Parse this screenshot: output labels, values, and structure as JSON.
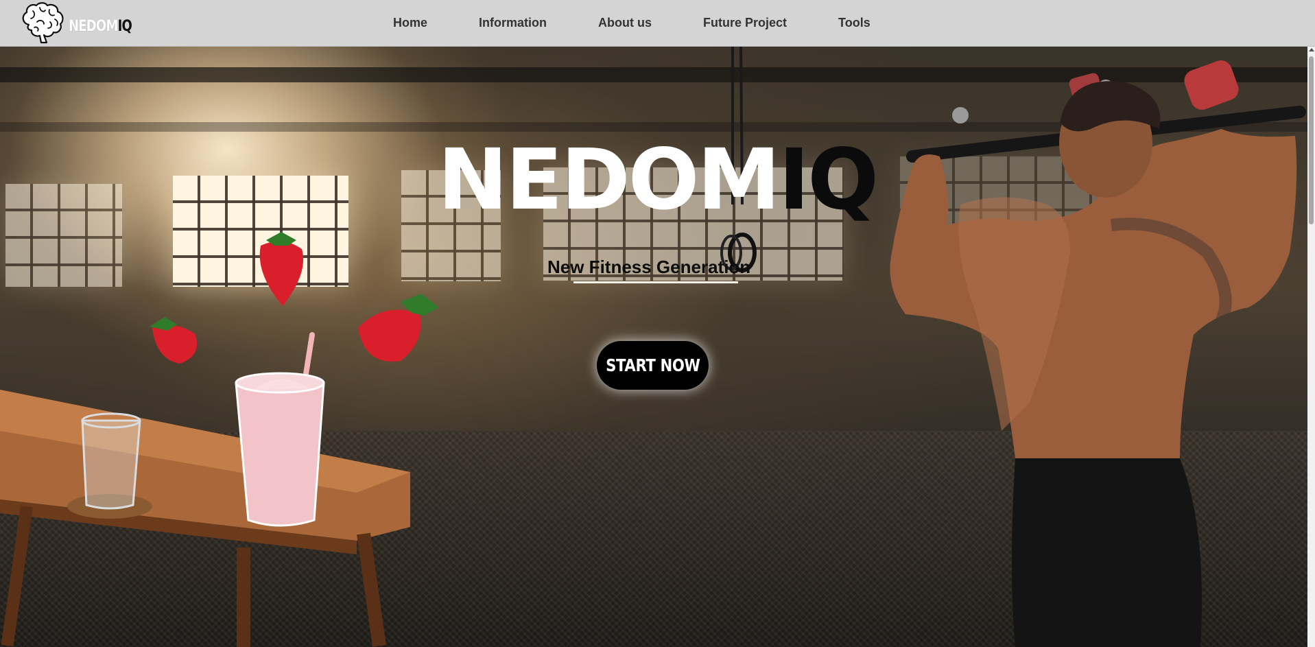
{
  "brand": {
    "name_white": "NEDOM",
    "name_black": "IQ",
    "logo_icon": "brain-icon"
  },
  "nav": {
    "items": [
      {
        "label": "Home"
      },
      {
        "label": "Information"
      },
      {
        "label": "About us"
      },
      {
        "label": "Future Project"
      },
      {
        "label": "Tools"
      }
    ]
  },
  "hero": {
    "title_white": "NEDOM",
    "title_black": "IQ",
    "tagline": "New Fitness Generation",
    "cta_label": "START NOW"
  },
  "colors": {
    "navbar_bg": "#d4d4d4",
    "cta_bg": "#000000",
    "cta_text": "#ffffff",
    "title_primary": "#ffffff",
    "title_accent": "#0b0b0b"
  }
}
